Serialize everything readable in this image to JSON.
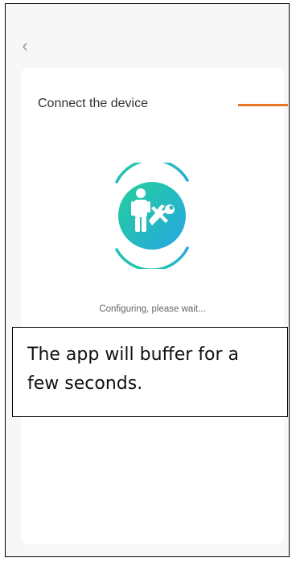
{
  "nav": {
    "back_icon": "chevron-left-icon",
    "back_glyph": "‹"
  },
  "card": {
    "title": "Connect the device",
    "status_text": "Configuring, please wait...",
    "illustration_icon": "worker-with-tools-icon"
  },
  "callout": {
    "text": "The app will buffer for a few seconds."
  },
  "colors": {
    "accent_orange": "#e87424",
    "gradient_start": "#23cf9a",
    "gradient_end": "#28a7e3",
    "page_bg": "#f7f7f7",
    "card_bg": "#ffffff"
  }
}
